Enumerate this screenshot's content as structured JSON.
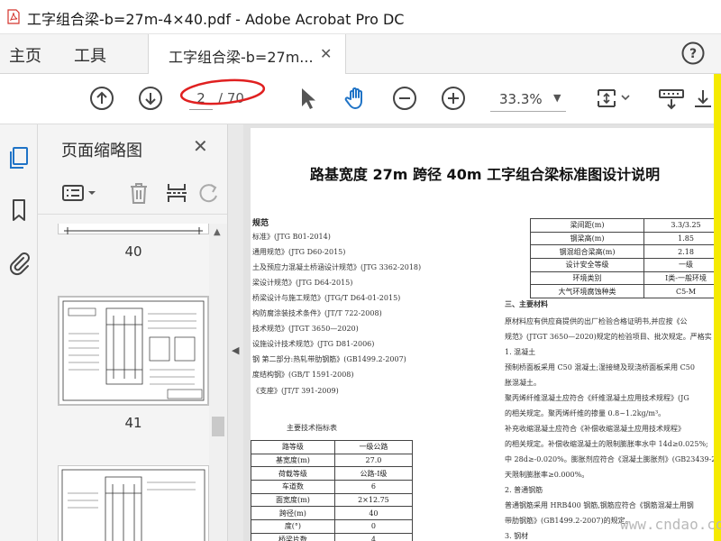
{
  "window": {
    "title": "工字组合梁-b=27m-4×40.pdf - Adobe Acrobat Pro DC",
    "controls": [
      "–",
      "□",
      "✕"
    ]
  },
  "nav": {
    "home_label": "主页",
    "tools_label": "工具",
    "tab_label": "工字组合梁-b=27m...",
    "tab_close": "✕",
    "help_icon": "help-icon"
  },
  "toolbar": {
    "current_page": "2",
    "total_pages": "/ 70",
    "zoom": "33.3%",
    "zoom_caret": "▼",
    "icons": [
      "page-up-icon",
      "page-down-icon",
      "select-arrow-icon",
      "hand-tool-icon",
      "zoom-out-icon",
      "zoom-in-icon",
      "fit-page-icon",
      "scroll-mode-icon",
      "download-icon"
    ],
    "annotation_color": "#e02020",
    "accent": "#1f73c6"
  },
  "sidebar": {
    "icons": [
      "page-thumbnails-icon",
      "bookmarks-icon",
      "attachments-icon"
    ]
  },
  "thumbnails": {
    "title": "页面缩略图",
    "close": "✕",
    "tools": [
      "options-menu-icon",
      "delete-page-icon",
      "insert-page-icon",
      "rotate-page-icon"
    ],
    "pages": [
      {
        "label": "40"
      },
      {
        "label": "41"
      },
      {
        "label": ""
      }
    ]
  },
  "document": {
    "title": "路基宽度 27m 跨径 40m 工字组合梁标准图设计说明",
    "standards_heading": "规范",
    "standards": [
      "标准》(JTG B01-2014)",
      "通用规范》(JTG D60-2015)",
      "土及预应力混凝土桥涵设计规范》(JTG 3362-2018)",
      "梁设计规范》(JTG D64-2015)",
      "桥梁设计与施工规范》(JTG/T D64-01-2015)",
      "构防腐涂装技术条件》(JT/T 722-2008)",
      "技术规范》(JTGT 3650—2020)",
      "设施设计技术规范》(JTG D81-2006)",
      "钢 第二部分:热轧带肋钢筋》(GB1499.2-2007)",
      "度结构钢》(GB/T 1591-2008)",
      "《支座》(JT/T 391-2009)"
    ],
    "right_table": [
      [
        "梁间距(m)",
        "3.3/3.25"
      ],
      [
        "钢梁高(m)",
        "1.85"
      ],
      [
        "钢混组合梁高(m)",
        "2.18"
      ],
      [
        "设计安全等级",
        "一级"
      ],
      [
        "环境类别",
        "Ⅰ类-一般环境"
      ],
      [
        "大气环境腐蚀种类",
        "C5-M"
      ]
    ],
    "right_text": [
      {
        "text": "三、主要材料",
        "head": true
      },
      {
        "text": "原材料应有供应商提供的出厂检验合格证明书,并应按《公",
        "head": false
      },
      {
        "text": "规范》(JTGT 3650—2020)规定的检验项目、批次规定。严格实",
        "head": false
      },
      {
        "text": "1. 混凝土",
        "head": false
      },
      {
        "text": "预制桥面板采用 C50 混凝土;湿接缝及现浇桥面板采用 C50",
        "head": false
      },
      {
        "text": "胀混凝土。",
        "head": false
      },
      {
        "text": "聚丙烯纤维混凝土应符合《纤维混凝土应用技术规程》(JG",
        "head": false
      },
      {
        "text": "的相关规定。聚丙烯纤维的掺量 0.8~1.2kg/m³。",
        "head": false
      },
      {
        "text": "补充收缩混凝土应符合《补偿收缩混凝土应用技术规程》",
        "head": false
      },
      {
        "text": "的相关规定。补偿收缩混凝土的限制膨胀率水中 14d≥0.025%;",
        "head": false
      },
      {
        "text": "中 28d≥-0.020%。膨胀剂应符合《混凝土膨胀剂》(GB23439-2",
        "head": false
      },
      {
        "text": "天限制膨胀率≥0.000%。",
        "head": false
      },
      {
        "text": "2. 普通钢筋",
        "head": false
      },
      {
        "text": "普通钢筋采用 HRB400 钢筋,钢筋应符合《钢筋混凝土用钢",
        "head": false
      },
      {
        "text": "带肋钢筋》(GB1499.2-2007)的规定。",
        "head": false
      },
      {
        "text": "3. 钢材",
        "head": false
      }
    ],
    "summary_caption": "主要技术指标表",
    "summary_table": [
      [
        "路等级",
        "一级公路"
      ],
      [
        "基宽度(m)",
        "27.0"
      ],
      [
        "荷载等级",
        "公路-Ⅰ级"
      ],
      [
        "车道数",
        "6"
      ],
      [
        "面宽度(m)",
        "2×12.75"
      ],
      [
        "跨径(m)",
        "40"
      ],
      [
        "度(°)",
        "0"
      ],
      [
        "桥梁片数",
        "4"
      ]
    ]
  },
  "watermark": "www.cndao.com"
}
